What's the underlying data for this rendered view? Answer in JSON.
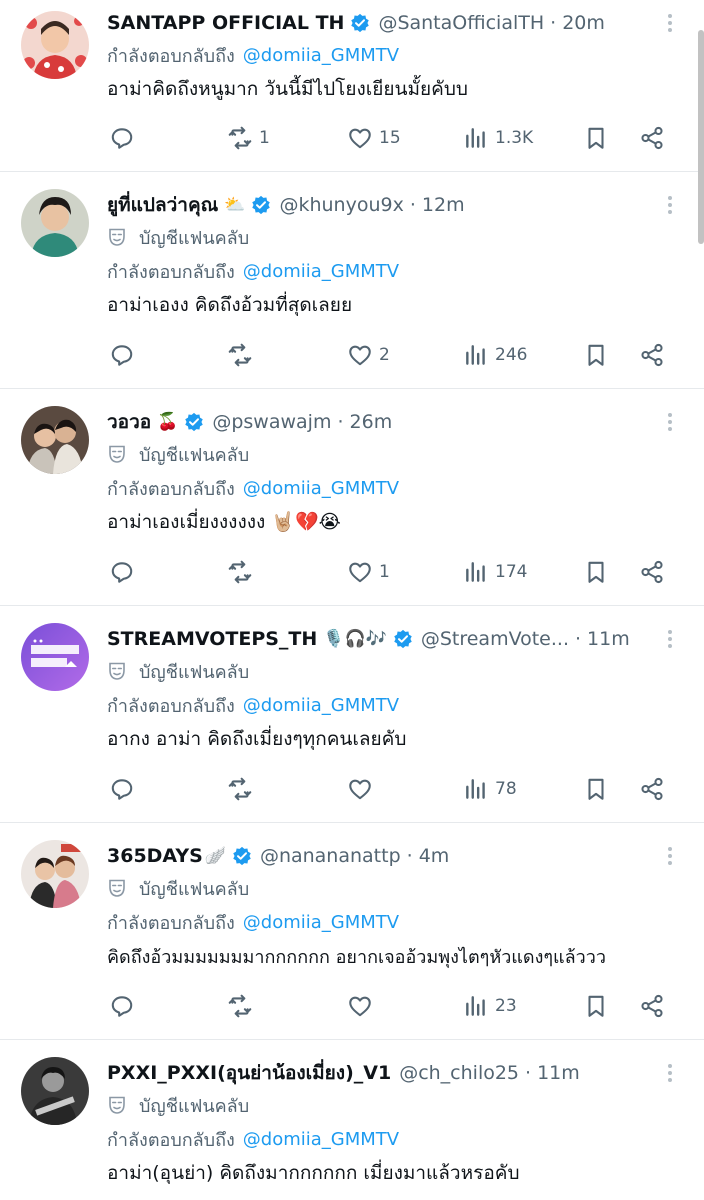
{
  "tweets": [
    {
      "display_name": "SANTAPP OFFICIAL TH",
      "name_emoji": "",
      "handle": "@SantaOfficialTH",
      "time": "20m",
      "fanclub_label": "",
      "reply_prefix": "กำลังตอบกลับถึง",
      "reply_to": "@domiia_GMMTV",
      "text": "อาม่าคิดถึงหนูมาก วันนี้มีไปโยงเยียนมั้ยคับบ",
      "replies": "",
      "retweets": "1",
      "likes": "15",
      "views": "1.3K"
    },
    {
      "display_name": "ยูที่แปลว่าคุณ",
      "name_emoji": "⛅",
      "handle": "@khunyou9x",
      "time": "12m",
      "fanclub_label": "บัญชีแฟนคลับ",
      "reply_prefix": "กำลังตอบกลับถึง",
      "reply_to": "@domiia_GMMTV",
      "text": "อาม่าเองง คิดถึงอ้วมที่สุดเลยย",
      "replies": "",
      "retweets": "",
      "likes": "2",
      "views": "246"
    },
    {
      "display_name": "วอวอ",
      "name_emoji": "🍒",
      "handle": "@pswawajm",
      "time": "26m",
      "fanclub_label": "บัญชีแฟนคลับ",
      "reply_prefix": "กำลังตอบกลับถึง",
      "reply_to": "@domiia_GMMTV",
      "text": "อาม่าเองเมี่ยงงงงงง 🤘🏼💔😭",
      "replies": "",
      "retweets": "",
      "likes": "1",
      "views": "174"
    },
    {
      "display_name": "STREAMVOTEPS_TH",
      "name_emoji": "🎙️🎧🎶",
      "handle": "@StreamVote...",
      "time": "11m",
      "fanclub_label": "บัญชีแฟนคลับ",
      "reply_prefix": "กำลังตอบกลับถึง",
      "reply_to": "@domiia_GMMTV",
      "text": "อากง อาม่า คิดถึงเมี่ยงๆทุกคนเลยคับ",
      "replies": "",
      "retweets": "",
      "likes": "",
      "views": "78"
    },
    {
      "display_name": "365DAYS",
      "name_emoji": "🪽",
      "handle": "@nanananattp",
      "time": "4m",
      "fanclub_label": "บัญชีแฟนคลับ",
      "reply_prefix": "กำลังตอบกลับถึง",
      "reply_to": "@domiia_GMMTV",
      "text": "คิดถึงอ้วมมมมมมมากกกกกก อยากเจออ้วมพุงไตๆหัวแดงๆแล้ววว",
      "replies": "",
      "retweets": "",
      "likes": "",
      "views": "23"
    },
    {
      "display_name": "PXXI_PXXI(อุนย่าน้องเมี่ยง)_V1",
      "name_emoji": "",
      "handle": "@ch_chilo25",
      "time": "11m",
      "fanclub_label": "บัญชีแฟนคลับ",
      "reply_prefix": "กำลังตอบกลับถึง",
      "reply_to": "@domiia_GMMTV",
      "text": "อาม่า(อุนย่า) คิดถึงมากกกกกก เมี่ยงมาแล้วหรอคับ"
    }
  ],
  "colors": {
    "text": "#0f1419",
    "muted": "#536471",
    "link": "#1d9bf0",
    "verified": "#1d9bf0",
    "divider": "#e6e9ec"
  },
  "icons": {
    "reply": "reply-icon",
    "retweet": "retweet-icon",
    "like": "heart-icon",
    "views": "views-icon",
    "bookmark": "bookmark-icon",
    "share": "share-icon",
    "verified": "verified-badge-icon",
    "fanclub": "mask-icon",
    "more": "more-dots-icon"
  }
}
